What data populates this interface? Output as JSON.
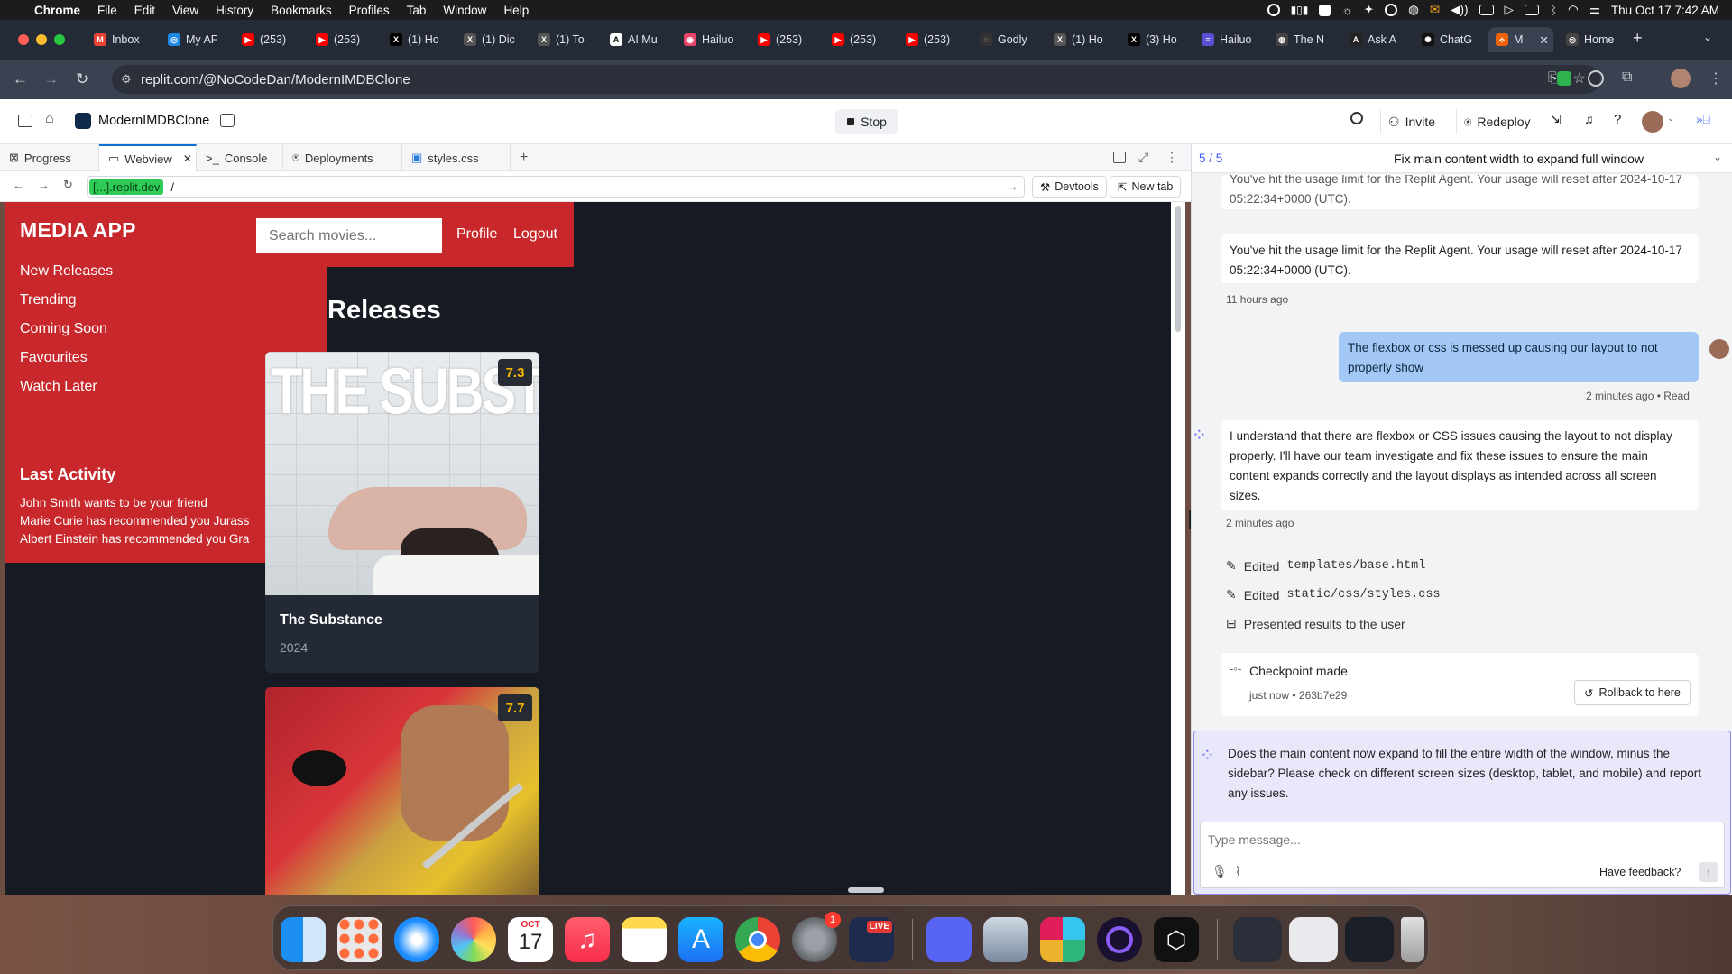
{
  "menubar": {
    "app": "Chrome",
    "items": [
      "File",
      "Edit",
      "View",
      "History",
      "Bookmarks",
      "Profiles",
      "Tab",
      "Window",
      "Help"
    ],
    "datetime": "Thu Oct 17  7:42 AM"
  },
  "browser_tabs": [
    {
      "label": "Inbox",
      "color": "#ea4335",
      "glyph": "M"
    },
    {
      "label": "My AF",
      "color": "#1e88e5",
      "glyph": "◎"
    },
    {
      "label": "(253)",
      "color": "#ff0000",
      "glyph": "▶"
    },
    {
      "label": "(253)",
      "color": "#ff0000",
      "glyph": "▶"
    },
    {
      "label": "(1) Ho",
      "color": "#000000",
      "glyph": "X"
    },
    {
      "label": "(1) Dic",
      "color": "#555555",
      "glyph": "X"
    },
    {
      "label": "(1) To",
      "color": "#555555",
      "glyph": "X"
    },
    {
      "label": "AI Mu",
      "color": "#ffffff",
      "glyph": "A"
    },
    {
      "label": "Hailuo",
      "color": "#e8456b",
      "glyph": "◉"
    },
    {
      "label": "(253)",
      "color": "#ff0000",
      "glyph": "▶"
    },
    {
      "label": "(253)",
      "color": "#ff0000",
      "glyph": "▶"
    },
    {
      "label": "(253)",
      "color": "#ff0000",
      "glyph": "▶"
    },
    {
      "label": "Godly",
      "color": "#333333",
      "glyph": "◌"
    },
    {
      "label": "(1) Ho",
      "color": "#555555",
      "glyph": "X"
    },
    {
      "label": "(3) Ho",
      "color": "#000000",
      "glyph": "X"
    },
    {
      "label": "Hailuo",
      "color": "#5b4fd6",
      "glyph": "≡"
    },
    {
      "label": "The N",
      "color": "#444444",
      "glyph": "◍"
    },
    {
      "label": "Ask A",
      "color": "#222222",
      "glyph": "A"
    },
    {
      "label": "ChatG",
      "color": "#111111",
      "glyph": "✺"
    },
    {
      "label": "M",
      "color": "#f26207",
      "glyph": "⟡"
    },
    {
      "label": "Home",
      "color": "#444444",
      "glyph": "◎"
    }
  ],
  "address": {
    "url": "replit.com/@NoCodeDan/ModernIMDBClone"
  },
  "replit": {
    "project": "ModernIMDBClone",
    "stop": "Stop",
    "invite": "Invite",
    "redeploy": "Redeploy",
    "tabs": [
      "Progress",
      "Webview",
      "Console",
      "Deployments",
      "styles.css"
    ],
    "webview_host": "[...].replit.dev",
    "webview_path": "/",
    "devtools": "Devtools",
    "new_tab": "New tab"
  },
  "app": {
    "logo": "MEDIA APP",
    "search_placeholder": "Search movies...",
    "profile": "Profile",
    "logout": "Logout",
    "nav": [
      "New Releases",
      "Trending",
      "Coming Soon",
      "Favourites",
      "Watch Later"
    ],
    "last_activity_title": "Last Activity",
    "activity": [
      "John Smith wants to be your friend",
      "Marie Curie has recommended you Jurass",
      "Albert Einstein has recommended you Gra"
    ],
    "section_title": "Releases",
    "movies": [
      {
        "title": "The Substance",
        "year": "2024",
        "rating": "7.3",
        "poster_text": "THE SUBSTANCE"
      },
      {
        "title": "",
        "year": "",
        "rating": "7.7",
        "poster_text": ""
      }
    ]
  },
  "agent": {
    "counter": "5 / 5",
    "title": "Fix main content width to expand full window",
    "msg1": "You've hit the usage limit for the Replit Agent. Your usage will reset after 2024-10-17 05:22:34+0000 (UTC).",
    "msg2": "You've hit the usage limit for the Replit Agent. Your usage will reset after 2024-10-17 05:22:34+0000 (UTC).",
    "time1": "11 hours ago",
    "user_msg": "The flexbox or css is messed up causing our layout to not properly show",
    "user_meta": "2 minutes ago • Read",
    "agent_msg": "I understand that there are flexbox or CSS issues causing the layout to not display properly. I'll have our team investigate and fix these issues to ensure the main content expands correctly and the layout displays as intended across all screen sizes.",
    "time2": "2 minutes ago",
    "steps": [
      {
        "prefix": "Edited",
        "file": "templates/base.html"
      },
      {
        "prefix": "Edited",
        "file": "static/css/styles.css"
      },
      {
        "prefix": "Presented results to the user",
        "file": ""
      }
    ],
    "checkpoint": "Checkpoint made",
    "checkpoint_meta": "just now • 263b7e29",
    "rollback": "Rollback to here",
    "question": "Does the main content now expand to fill the entire width of the window, minus the sidebar? Please check on different screen sizes (desktop, tablet, and mobile) and report any issues.",
    "input_placeholder": "Type message...",
    "feedback": "Have feedback?"
  },
  "dock": {
    "calendar_month": "OCT",
    "calendar_day": "17",
    "settings_badge": "1",
    "live": "LIVE"
  }
}
